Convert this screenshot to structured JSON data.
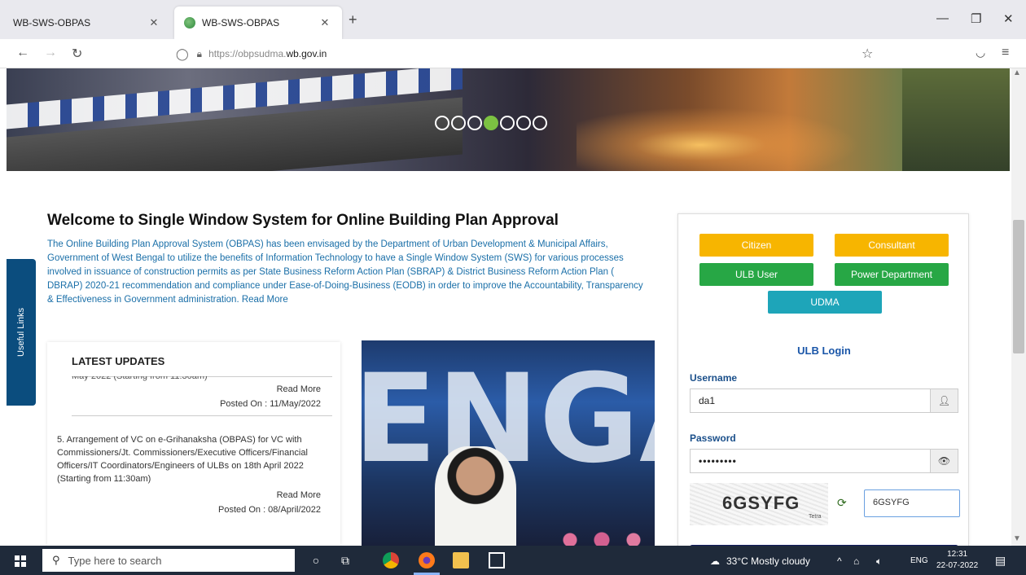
{
  "browser": {
    "tabs": [
      {
        "title": "WB-SWS-OBPAS",
        "active": false
      },
      {
        "title": "WB-SWS-OBPAS",
        "active": true
      }
    ],
    "url_prefix": "https://obpsudma.",
    "url_domain": "wb.gov.in"
  },
  "banner": {
    "slide_count": 7,
    "active_slide": 4
  },
  "sidebar_tab": "Useful Links",
  "welcome": {
    "title": "Welcome to Single Window System for Online Building Plan Approval",
    "body": "The Online Building Plan Approval System (OBPAS) has been envisaged by the Department of Urban Development & Municipal Affairs, Government of West Bengal to utilize the benefits of Information Technology to have a Single Window System (SWS) for various processes involved in issuance of construction permits as per State Business Reform Action Plan (SBRAP) & District Business Reform Action Plan ( DBRAP) 2020-21 recommendation and compliance under Ease-of-Doing-Business (EODB) in order to improve the Accountability, Transparency & Effectiveness in Government administration.",
    "read_more": "Read More"
  },
  "updates": {
    "heading": "LATEST UPDATES",
    "items": [
      {
        "text": "May 2022 (Starting from 11:30am)",
        "read_more": "Read More",
        "posted": "Posted On : 11/May/2022"
      },
      {
        "text": "5. Arrangement of VC on e-Grihanaksha (OBPAS) for VC with Commissioners/Jt. Commissioners/Executive Officers/Financial Officers/IT Coordinators/Engineers of ULBs on 18th April 2022 (Starting from 11:30am)",
        "read_more": "Read More",
        "posted": "Posted On : 08/April/2022"
      }
    ]
  },
  "photo": {
    "backdrop_text": "ENGA"
  },
  "login": {
    "roles": {
      "citizen": "Citizen",
      "consultant": "Consultant",
      "ulb_user": "ULB User",
      "power_department": "Power Department",
      "udma": "UDMA"
    },
    "title": "ULB Login",
    "username_label": "Username",
    "username_value": "da1",
    "password_label": "Password",
    "password_value": "•••••••••",
    "captcha_text": "6GSYFG",
    "captcha_brand": "Tetra",
    "captcha_input": "6GSYFG"
  },
  "taskbar": {
    "search_placeholder": "Type here to search",
    "weather": "33°C  Mostly cloudy",
    "language": "ENG",
    "time": "12:31",
    "date": "22-07-2022"
  },
  "colors": {
    "citizen": "#f7b500",
    "ulb": "#27a745",
    "udma": "#1ea5b9",
    "link": "#1a6fa8",
    "sidebar": "#0b4d7e"
  }
}
